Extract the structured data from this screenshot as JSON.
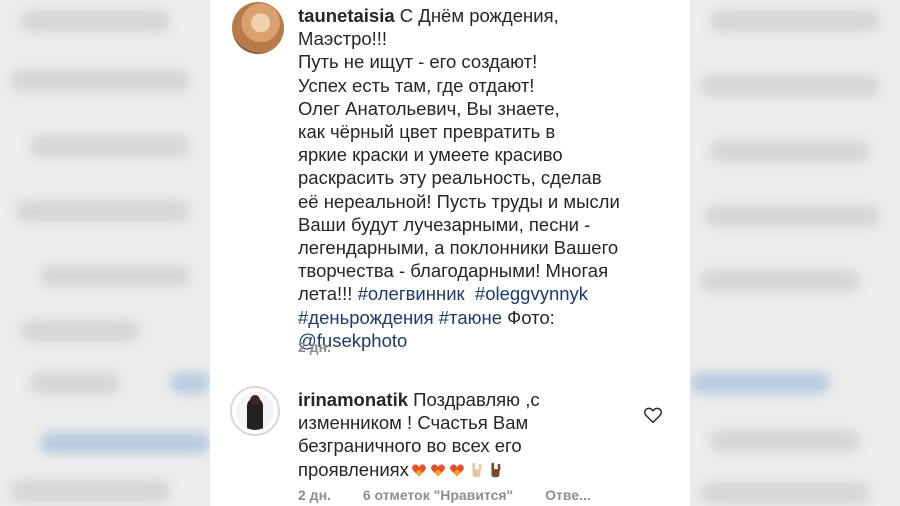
{
  "post": {
    "username": "taunetaisia",
    "lines": [
      [
        "С Днём рождения,"
      ],
      [
        "Маэстро!!!"
      ],
      [
        "Путь не ищут - его создают!"
      ],
      [
        "Успех есть там, где отдают!"
      ],
      [
        "Олег Анатольевич, Вы знаете,"
      ],
      [
        "как чёрный цвет превратить в"
      ],
      [
        "яркие краски и умеете красиво"
      ],
      [
        "раскрасить эту реальность, сделав"
      ],
      [
        "её нереальной! Пусть труды и мысли"
      ],
      [
        "Ваши будут лучезарными, песни -"
      ],
      [
        "легендарными, а поклонники Вашего"
      ],
      [
        "творчества - благодарными! Многая"
      ]
    ],
    "line13_text": "лета!!! ",
    "hashtags": {
      "h1": "#олегвинник",
      "h2": "#oleggvynnyk",
      "h3": "#деньрождения",
      "h4": "#таюне"
    },
    "photo_label": " Фото:",
    "photo_mention": "@fusekphoto",
    "time": "2 дн."
  },
  "comment": {
    "username": "irinamonatik",
    "text_line1": "Поздравляю ,с",
    "text_line2": "изменником ! Счастья Вам",
    "text_line3": "безграничного во всех его",
    "text_line4": "проявлениях",
    "emojis": [
      "heart-hands-emoji",
      "heart-hands-emoji",
      "heart-hands-emoji",
      "rock-hand-emoji",
      "rock-hand-emoji"
    ],
    "time": "2 дн.",
    "likes": "6 отметок \"Нравится\"",
    "reply": "Отве..."
  }
}
